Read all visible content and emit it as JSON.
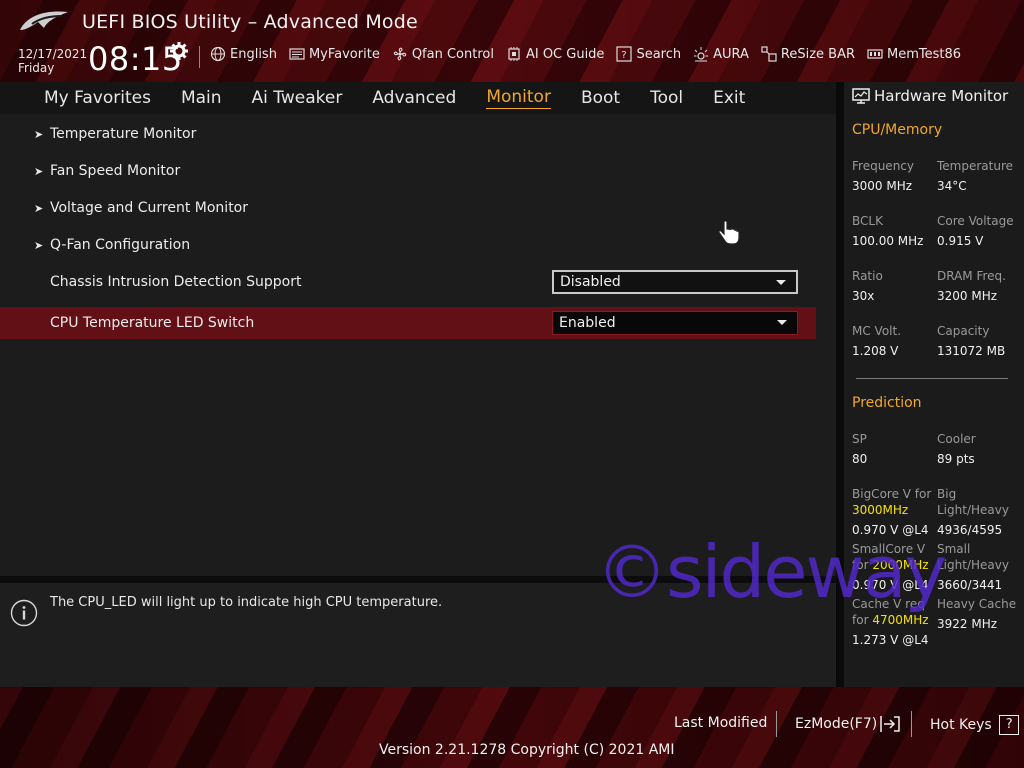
{
  "header": {
    "title": "UEFI BIOS Utility – Advanced Mode",
    "date": "12/17/2021",
    "day": "Friday",
    "time": "08:15",
    "toolbar": [
      {
        "label": "English",
        "icon": "globe-icon"
      },
      {
        "label": "MyFavorite",
        "icon": "favorite-list-icon"
      },
      {
        "label": "Qfan Control",
        "icon": "fan-icon"
      },
      {
        "label": "AI OC Guide",
        "icon": "oc-guide-icon"
      },
      {
        "label": "Search",
        "icon": "search-icon"
      },
      {
        "label": "AURA",
        "icon": "aura-light-icon"
      },
      {
        "label": "ReSize BAR",
        "icon": "resize-bar-icon"
      },
      {
        "label": "MemTest86",
        "icon": "memtest-icon"
      }
    ]
  },
  "nav": {
    "tabs": [
      "My Favorites",
      "Main",
      "Ai Tweaker",
      "Advanced",
      "Monitor",
      "Boot",
      "Tool",
      "Exit"
    ],
    "active": "Monitor"
  },
  "menu": {
    "submenus": [
      "Temperature Monitor",
      "Fan Speed Monitor",
      "Voltage and Current Monitor",
      "Q-Fan Configuration"
    ],
    "settings": [
      {
        "label": "Chassis Intrusion Detection Support",
        "value": "Disabled"
      },
      {
        "label": "CPU Temperature LED Switch",
        "value": "Enabled"
      }
    ]
  },
  "help": {
    "text": "The CPU_LED will light up to indicate high CPU temperature."
  },
  "hardware_monitor": {
    "title": "Hardware Monitor",
    "cpu_memory_heading": "CPU/Memory",
    "cpu_memory": [
      {
        "key": "Frequency",
        "value": "3000 MHz"
      },
      {
        "key": "Temperature",
        "value": "34°C"
      },
      {
        "key": "BCLK",
        "value": "100.00 MHz"
      },
      {
        "key": "Core Voltage",
        "value": "0.915 V"
      },
      {
        "key": "Ratio",
        "value": "30x"
      },
      {
        "key": "DRAM Freq.",
        "value": "3200 MHz"
      },
      {
        "key": "MC Volt.",
        "value": "1.208 V"
      },
      {
        "key": "Capacity",
        "value": "131072 MB"
      }
    ],
    "prediction_heading": "Prediction",
    "prediction": {
      "sp_key": "SP",
      "sp_value": "80",
      "cooler_key": "Cooler",
      "cooler_value": "89 pts",
      "bigcore_key": "BigCore V for",
      "bigcore_freq": "3000MHz",
      "bigcore_value": "0.970 V @L4",
      "big_lh_key_1": "Big",
      "big_lh_key_2": "Light/Heavy",
      "big_lh_value": "4936/4595",
      "smallcore_key_1": "SmallCore V",
      "smallcore_key_2": "for",
      "smallcore_freq": "2000MHz",
      "smallcore_value": "0.970 V @L4",
      "small_lh_key_1": "Small",
      "small_lh_key_2": "Light/Heavy",
      "small_lh_value": "3660/3441",
      "cache_key_1": "Cache V req",
      "cache_key_2": "for",
      "cache_freq": "4700MHz",
      "cache_value": "1.273 V @L4",
      "heavy_cache_key": "Heavy Cache",
      "heavy_cache_value": "3922 MHz"
    }
  },
  "watermark": "©sideway",
  "footer": {
    "last_modified": "Last Modified",
    "ezmode": "EzMode(F7)",
    "hot_keys": "Hot Keys",
    "hot_keys_icon_text": "?",
    "version": "Version 2.21.1278 Copyright (C) 2021 AMI"
  },
  "colors": {
    "accent": "#f2a72b",
    "selected_row": "#621016",
    "highlight_freq": "#f5e200",
    "watermark": "#5028c8"
  }
}
